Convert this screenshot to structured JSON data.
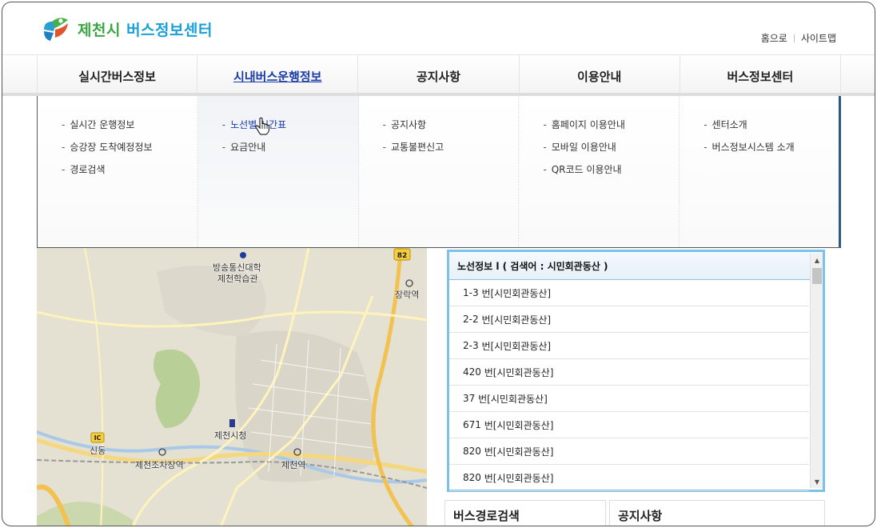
{
  "logo": {
    "city": "제천시",
    "title": "버스정보센터"
  },
  "top_links": {
    "home": "홈으로",
    "sitemap": "사이트맵"
  },
  "gnb": [
    {
      "label": "실시간버스정보",
      "color": "#1e88d8"
    },
    {
      "label": "시내버스운행정보",
      "color": "#1a3ca8"
    },
    {
      "label": "공지사항",
      "color": "#c8c8c8"
    },
    {
      "label": "이용안내",
      "color": "#8a8a8a"
    },
    {
      "label": "버스정보센터",
      "color": "#e8541c"
    }
  ],
  "submenu": [
    [
      "실시간 운행정보",
      "승강장 도착예정정보",
      "경로검색"
    ],
    [
      "노선별 시간표",
      "요금안내"
    ],
    [
      "공지사항",
      "교통불편신고"
    ],
    [
      "홈페이지 이용안내",
      "모바일 이용안내",
      "QR코드 이용안내"
    ],
    [
      "센터소개",
      "버스정보시스템 소개"
    ]
  ],
  "submenu_dash": "-",
  "map": {
    "road_badge": "82",
    "ic_badge": "IC",
    "labels": {
      "univ": "방송통신대학",
      "univ2": "제천학습관",
      "station1": "장락역",
      "cityhall": "제천시청",
      "sindong": "신동",
      "yard": "제천조차장역",
      "station2": "제천역"
    }
  },
  "route_panel": {
    "header": "노선정보 l ( 검색어 : 시민회관동산 )",
    "rows": [
      {
        "num": "1-3",
        "unit": "번",
        "stop": "[시민회관동산]"
      },
      {
        "num": "2-2",
        "unit": "번",
        "stop": "[시민회관동산]"
      },
      {
        "num": "2-3",
        "unit": "번",
        "stop": "[시민회관동산]"
      },
      {
        "num": "420",
        "unit": "번",
        "stop": "[시민회관동산]"
      },
      {
        "num": "37",
        "unit": "번",
        "stop": "[시민회관동산]"
      },
      {
        "num": "671",
        "unit": "번",
        "stop": "[시민회관동산]"
      },
      {
        "num": "820",
        "unit": "번",
        "stop": "[시민회관동산]"
      },
      {
        "num": "820",
        "unit": "번",
        "stop": "[시민회관동산]"
      }
    ],
    "scroll_up": "▲",
    "scroll_down": "▼"
  },
  "bottom": {
    "route_search": "버스경로검색",
    "notice": "공지사항"
  }
}
